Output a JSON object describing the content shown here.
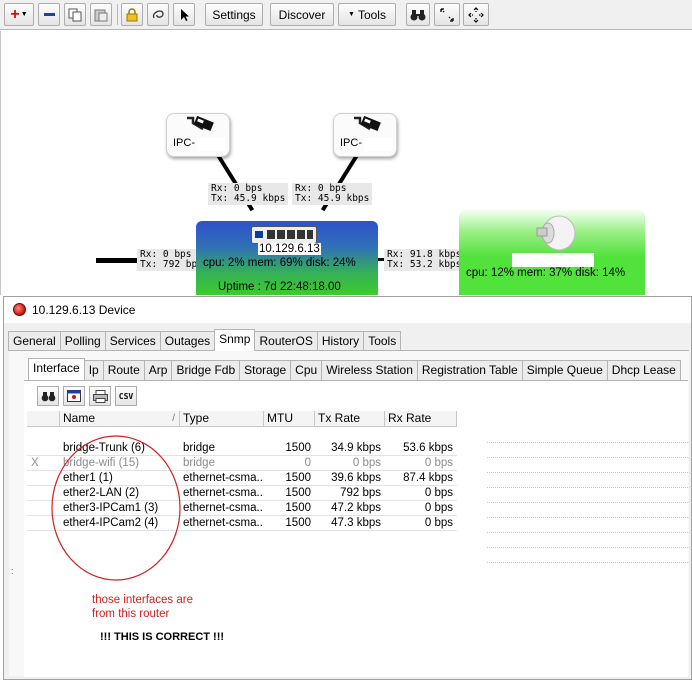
{
  "toolbar": {
    "settings_label": "Settings",
    "discover_label": "Discover",
    "tools_label": "Tools"
  },
  "map": {
    "camera1_label": "IPC-",
    "camera2_label": "IPC-",
    "link_cam1": "Rx: 0 bps\nTx: 45.9 kbps",
    "link_cam2": "Rx: 0 bps\nTx: 45.9 kbps",
    "link_left": "Rx: 0 bps\nTx: 792 bps",
    "link_right": "Rx: 91.8 kbps\nTx: 53.2 kbps",
    "router_ip": "10.129.6.13",
    "router_stats": "cpu: 2% mem: 69% disk: 24%",
    "router_uptime": "Uptime : 7d 22:48:18.00",
    "ap_stats": "cpu: 12% mem: 37% disk: 14%"
  },
  "device_window": {
    "title": "10.129.6.13 Device",
    "tabs": [
      "General",
      "Polling",
      "Services",
      "Outages",
      "Snmp",
      "RouterOS",
      "History",
      "Tools"
    ],
    "active_tab": "Snmp",
    "snmp_tabs": [
      "Interface",
      "Ip",
      "Route",
      "Arp",
      "Bridge Fdb",
      "Storage",
      "Cpu",
      "Wireless Station",
      "Registration Table",
      "Simple Queue",
      "Dhcp Lease"
    ],
    "active_snmp_tab": "Interface",
    "csv_label": "CSV",
    "table": {
      "columns": [
        "Name",
        "Type",
        "MTU",
        "Tx Rate",
        "Rx Rate"
      ],
      "rows": [
        {
          "flag": "",
          "name": "bridge-Trunk (6)",
          "type": "bridge",
          "mtu": "1500",
          "tx": "34.9 kbps",
          "rx": "53.6 kbps",
          "disabled": false
        },
        {
          "flag": "X",
          "name": "bridge-wifi (15)",
          "type": "bridge",
          "mtu": "0",
          "tx": "0 bps",
          "rx": "0 bps",
          "disabled": true
        },
        {
          "flag": "",
          "name": "ether1 (1)",
          "type": "ethernet-csma...",
          "mtu": "1500",
          "tx": "39.6 kbps",
          "rx": "87.4 kbps",
          "disabled": false
        },
        {
          "flag": "",
          "name": "ether2-LAN (2)",
          "type": "ethernet-csma...",
          "mtu": "1500",
          "tx": "792 bps",
          "rx": "0 bps",
          "disabled": false
        },
        {
          "flag": "",
          "name": "ether3-IPCam1 (3)",
          "type": "ethernet-csma...",
          "mtu": "1500",
          "tx": "47.2 kbps",
          "rx": "0 bps",
          "disabled": false
        },
        {
          "flag": "",
          "name": "ether4-IPCam2 (4)",
          "type": "ethernet-csma...",
          "mtu": "1500",
          "tx": "47.3 kbps",
          "rx": "0 bps",
          "disabled": false
        }
      ]
    }
  },
  "annotation": {
    "note": "those interfaces are\nfrom this router",
    "verdict": "!!! THIS IS CORRECT !!!"
  },
  "colors": {
    "router_top": "#2e52c8",
    "router_bottom": "#3ccc2a",
    "ap_green": "#52e23c",
    "annotation_red": "#d02020"
  }
}
